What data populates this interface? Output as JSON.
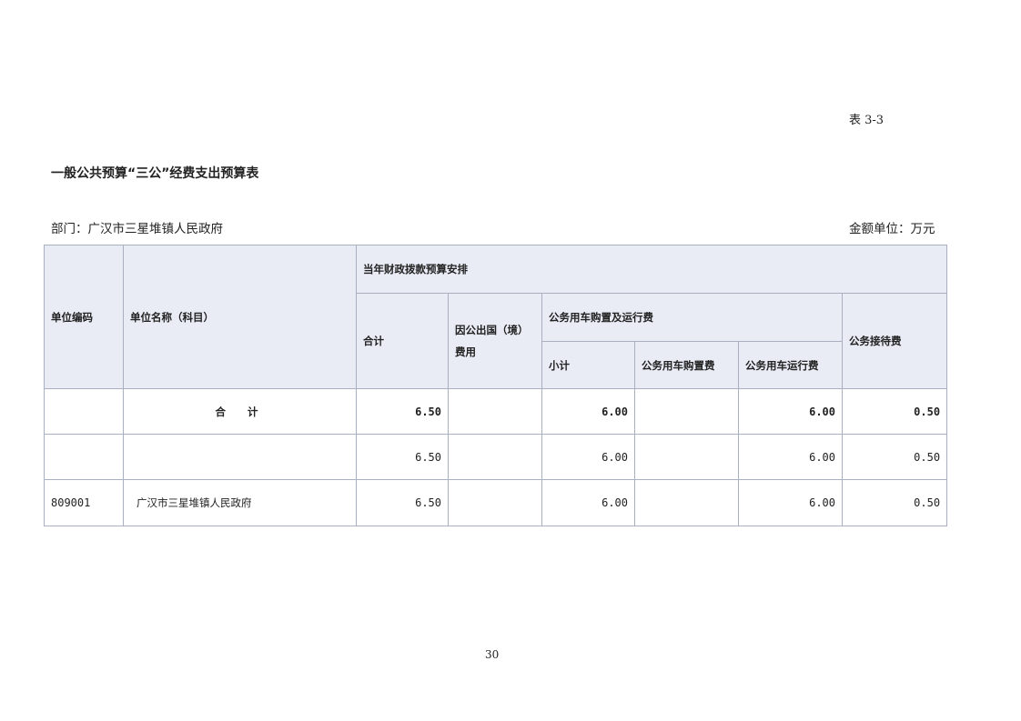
{
  "table_no": "表 3-3",
  "title": "一般公共预算“三公”经费支出预算表",
  "department": "部门：广汉市三星堆镇人民政府",
  "currency_unit": "金额单位：万元",
  "headers": {
    "unit_code": "单位编码",
    "unit_name": "单位名称（科目）",
    "current_year": "当年财政拨款预算安排",
    "total": "合计",
    "abroad_line1": "因公出国（境）",
    "abroad_line2": "费用",
    "vehicle": "公务用车购置及运行费",
    "subtotal": "小计",
    "vehicle_purchase": "公务用车购置费",
    "vehicle_operation": "公务用车运行费",
    "reception": "公务接待费"
  },
  "rows": [
    {
      "code": "",
      "name": "合计",
      "total": "6.50",
      "abroad": "",
      "subtotal": "6.00",
      "purchase": "",
      "operation": "6.00",
      "reception": "0.50"
    },
    {
      "code": "",
      "name": "",
      "total": "6.50",
      "abroad": "",
      "subtotal": "6.00",
      "purchase": "",
      "operation": "6.00",
      "reception": "0.50"
    },
    {
      "code": "809001",
      "name": "广汉市三星堆镇人民政府",
      "total": "6.50",
      "abroad": "",
      "subtotal": "6.00",
      "purchase": "",
      "operation": "6.00",
      "reception": "0.50"
    }
  ],
  "page_number": "30"
}
